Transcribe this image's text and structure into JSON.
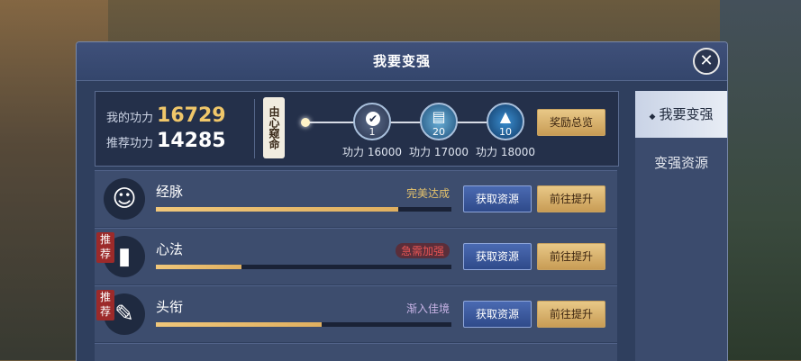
{
  "dialog": {
    "title": "我要变强",
    "close_label": "✕"
  },
  "sidebar": {
    "tabs": [
      {
        "label": "我要变强",
        "active": true
      },
      {
        "label": "变强资源",
        "active": false
      }
    ]
  },
  "power": {
    "my_label": "我的功力",
    "my_value": "16729",
    "rec_label": "推荐功力",
    "rec_value": "14285",
    "tag": "由心窥命",
    "milestones": [
      {
        "icon": "check-icon",
        "count": "1",
        "label": "功力 16000",
        "done": true
      },
      {
        "icon": "scroll-icon",
        "count": "20",
        "label": "功力 17000",
        "done": false
      },
      {
        "icon": "upgrade-gem-icon",
        "count": "10",
        "label": "功力 18000",
        "done": false
      }
    ],
    "reward_button": "奖励总览"
  },
  "rows": [
    {
      "name": "经脉",
      "icon": "mask-icon",
      "recommended": false,
      "status": "完美达成",
      "status_style": "gold",
      "progress": 0.82,
      "get_button": "获取资源",
      "go_button": "前往提升"
    },
    {
      "name": "心法",
      "icon": "book-icon",
      "recommended": true,
      "rec_label": "推荐",
      "status": "急需加强",
      "status_style": "red",
      "progress": 0.29,
      "get_button": "获取资源",
      "go_button": "前往提升"
    },
    {
      "name": "头衔",
      "icon": "brush-icon",
      "recommended": true,
      "rec_label": "推荐",
      "status": "渐入佳境",
      "status_style": "purple",
      "progress": 0.56,
      "get_button": "获取资源",
      "go_button": "前往提升"
    }
  ]
}
